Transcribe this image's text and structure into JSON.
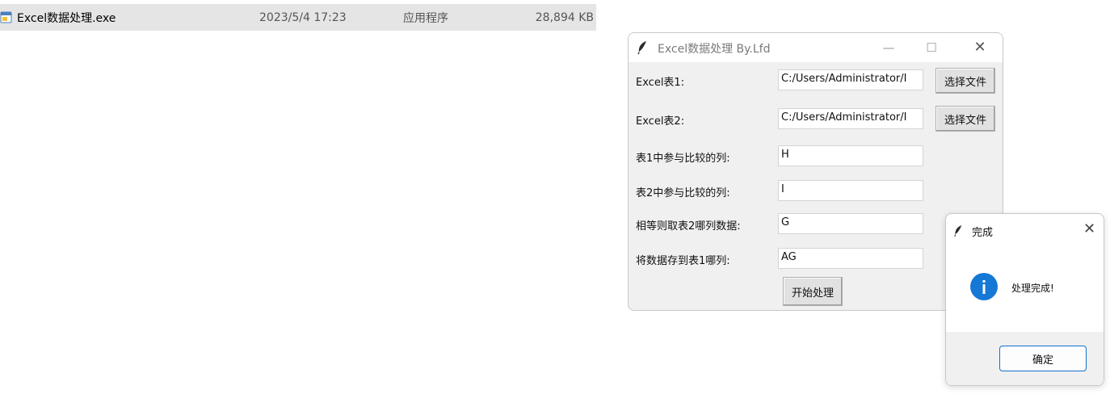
{
  "file_row": {
    "name": "Excel数据处理.exe",
    "date": "2023/5/4 17:23",
    "type": "应用程序",
    "size": "28,894 KB",
    "icon": "exe-file-icon"
  },
  "main_window": {
    "title": "Excel数据处理  By.Lfd",
    "app_icon": "feather-icon",
    "minimize_glyph": "—",
    "maximize_glyph": "☐",
    "close_glyph": "✕",
    "fields": {
      "excel1_label": "Excel表1:",
      "excel1_value": "C:/Users/Administrator/I",
      "excel2_label": "Excel表2:",
      "excel2_value": "C:/Users/Administrator/I",
      "col1_label": "表1中参与比较的列:",
      "col1_value": "H",
      "col2_label": "表2中参与比较的列:",
      "col2_value": "I",
      "take_label": "相等则取表2哪列数据:",
      "take_value": "G",
      "save_label": "将数据存到表1哪列:",
      "save_value": "AG"
    },
    "choose_file_label": "选择文件",
    "start_label": "开始处理"
  },
  "dialog": {
    "title": "完成",
    "message": "处理完成!",
    "ok_label": "确定",
    "close_glyph": "✕",
    "info_glyph": "i"
  },
  "colors": {
    "accent": "#1578d6",
    "window_bg": "#f0f0f0",
    "file_row_highlight": "#e5e5e5"
  }
}
